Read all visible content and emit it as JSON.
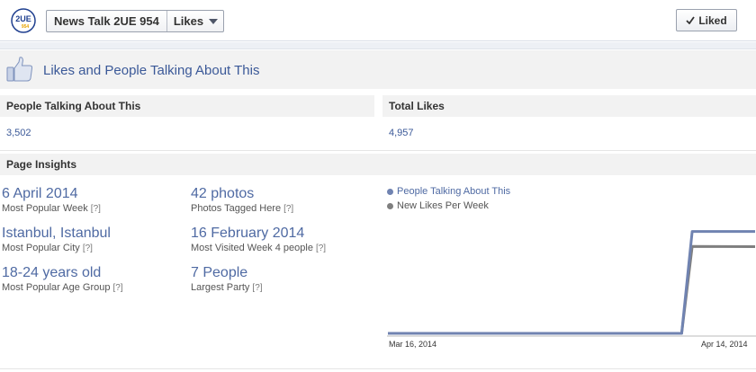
{
  "topbar": {
    "logo_text": "2UE",
    "logo_sub": "954",
    "page_name": "News Talk 2UE 954",
    "dropdown_label": "Likes",
    "liked_label": "Liked"
  },
  "section": {
    "title": "Likes and People Talking About This"
  },
  "stats": {
    "talking_label": "People Talking About This",
    "talking_value": "3,502",
    "likes_label": "Total Likes",
    "likes_value": "4,957"
  },
  "insights": {
    "header": "Page Insights",
    "help": "[?]",
    "metrics": [
      {
        "value": "6 April 2014",
        "label": "Most Popular Week"
      },
      {
        "value": "Istanbul, Istanbul",
        "label": "Most Popular City"
      },
      {
        "value": "18-24 years old",
        "label": "Most Popular Age Group"
      },
      {
        "value": "42 photos",
        "label": "Photos Tagged Here"
      },
      {
        "value": "16 February 2014",
        "label": "Most Visited Week 4 people"
      },
      {
        "value": "7 People",
        "label": "Largest Party"
      }
    ]
  },
  "chart_data": {
    "type": "line",
    "x": [
      "Mar 16, 2014",
      "Mar 23, 2014",
      "Mar 30, 2014",
      "Apr 6, 2014",
      "Apr 13, 2014",
      "Apr 14, 2014",
      "Apr 20, 2014"
    ],
    "x_tick_labels": [
      "Mar 16, 2014",
      "Apr 14, 2014"
    ],
    "series": [
      {
        "name": "People Talking About This",
        "color": "#7083b1",
        "values": [
          0,
          0,
          0,
          0,
          0,
          3502,
          3502
        ]
      },
      {
        "name": "New Likes Per Week",
        "color": "#7f7f7f",
        "values": [
          0,
          0,
          0,
          0,
          0,
          2990,
          2980
        ]
      }
    ],
    "ylim": [
      0,
      3800
    ],
    "grid": false,
    "legend": "top-left"
  },
  "colors": {
    "link_blue": "#3b5998",
    "metric_blue": "#4f6aa3",
    "header_gray": "#f2f2f2"
  }
}
